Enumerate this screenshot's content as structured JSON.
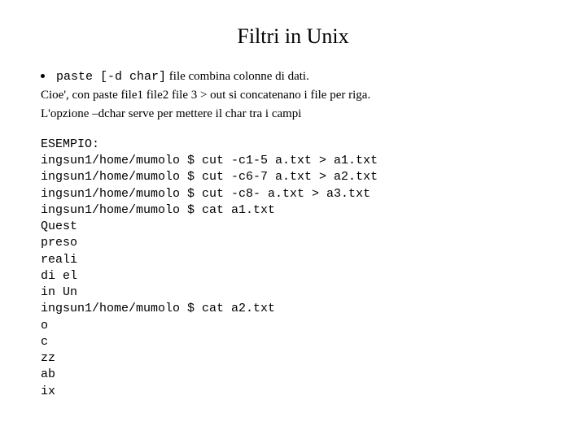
{
  "title": "Filtri in Unix",
  "bullet": {
    "cmd": "paste [-d char]",
    "rest": " file combina colonne di dati."
  },
  "desc_line1": "Cioe', con paste file1 file2 file 3 > out si concatenano i file per riga.",
  "desc_line2": "L'opzione –dchar serve per mettere il char tra i campi",
  "example": "ESEMPIO:\ningsun1/home/mumolo $ cut -c1-5 a.txt > a1.txt\ningsun1/home/mumolo $ cut -c6-7 a.txt > a2.txt\ningsun1/home/mumolo $ cut -c8- a.txt > a3.txt\ningsun1/home/mumolo $ cat a1.txt\nQuest\npreso\nreali\ndi el\nin Un\ningsun1/home/mumolo $ cat a2.txt\no\nc\nzz\nab\nix"
}
